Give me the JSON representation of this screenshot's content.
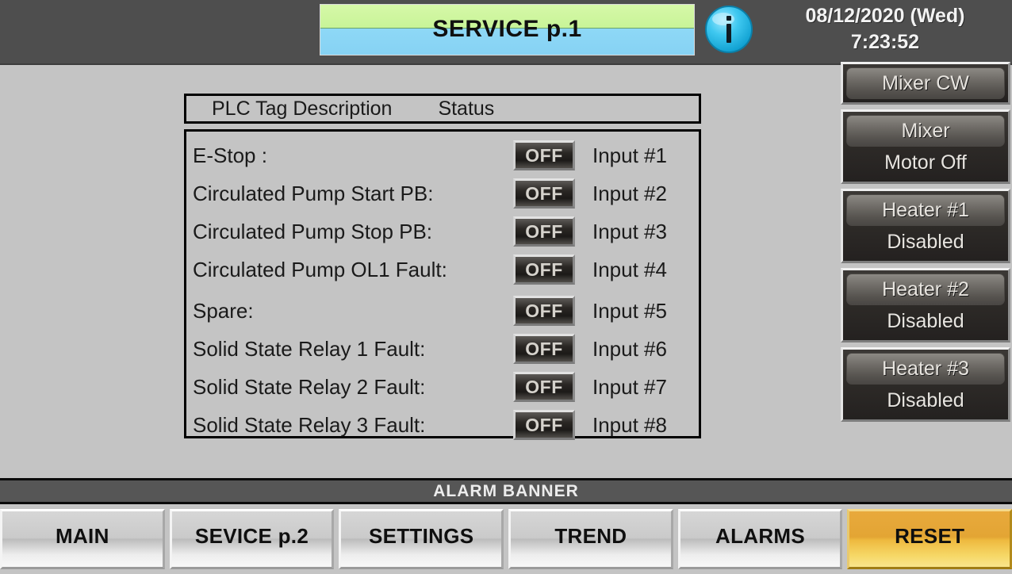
{
  "header": {
    "title": "SERVICE p.1",
    "info_icon": "info-circle-icon",
    "date": "08/12/2020 (Wed)",
    "time": "7:23:52"
  },
  "plc_table": {
    "column_description": "PLC Tag Description",
    "column_status": "Status",
    "rows": [
      {
        "tag": "E-Stop :",
        "status": "OFF",
        "input": "Input #1"
      },
      {
        "tag": "Circulated Pump Start PB:",
        "status": "OFF",
        "input": "Input #2"
      },
      {
        "tag": "Circulated Pump Stop PB:",
        "status": "OFF",
        "input": "Input #3"
      },
      {
        "tag": "Circulated Pump OL1 Fault:",
        "status": "OFF",
        "input": "Input #4"
      },
      {
        "tag": "Spare:",
        "status": "OFF",
        "input": "Input #5"
      },
      {
        "tag": "Solid State Relay 1 Fault:",
        "status": "OFF",
        "input": "Input #6"
      },
      {
        "tag": "Solid State Relay 2 Fault:",
        "status": "OFF",
        "input": "Input #7"
      },
      {
        "tag": "Solid State Relay 3 Fault:",
        "status": "OFF",
        "input": "Input #8"
      }
    ]
  },
  "sidebar": {
    "buttons": [
      {
        "label": "Mixer CW",
        "status": ""
      },
      {
        "label": "Mixer",
        "status": "Motor Off"
      },
      {
        "label": "Heater #1",
        "status": "Disabled"
      },
      {
        "label": "Heater #2",
        "status": "Disabled"
      },
      {
        "label": "Heater #3",
        "status": "Disabled"
      }
    ]
  },
  "alarm_banner": {
    "text": "ALARM BANNER"
  },
  "bottom_nav": {
    "buttons": [
      {
        "label": "MAIN",
        "accent": false
      },
      {
        "label": "SEVICE p.2",
        "accent": false
      },
      {
        "label": "SETTINGS",
        "accent": false
      },
      {
        "label": "TREND",
        "accent": false
      },
      {
        "label": "ALARMS",
        "accent": false
      },
      {
        "label": "RESET",
        "accent": true
      }
    ]
  },
  "colors": {
    "screen_background": "#c4c4c4",
    "top_bar": "#4e4e4e",
    "banner_green": "#c8f498",
    "banner_blue": "#86d2f4",
    "alarm_banner": "#565656",
    "reset_accent": "#e8a93c",
    "indicator_off_text": "#d5d2cc"
  }
}
